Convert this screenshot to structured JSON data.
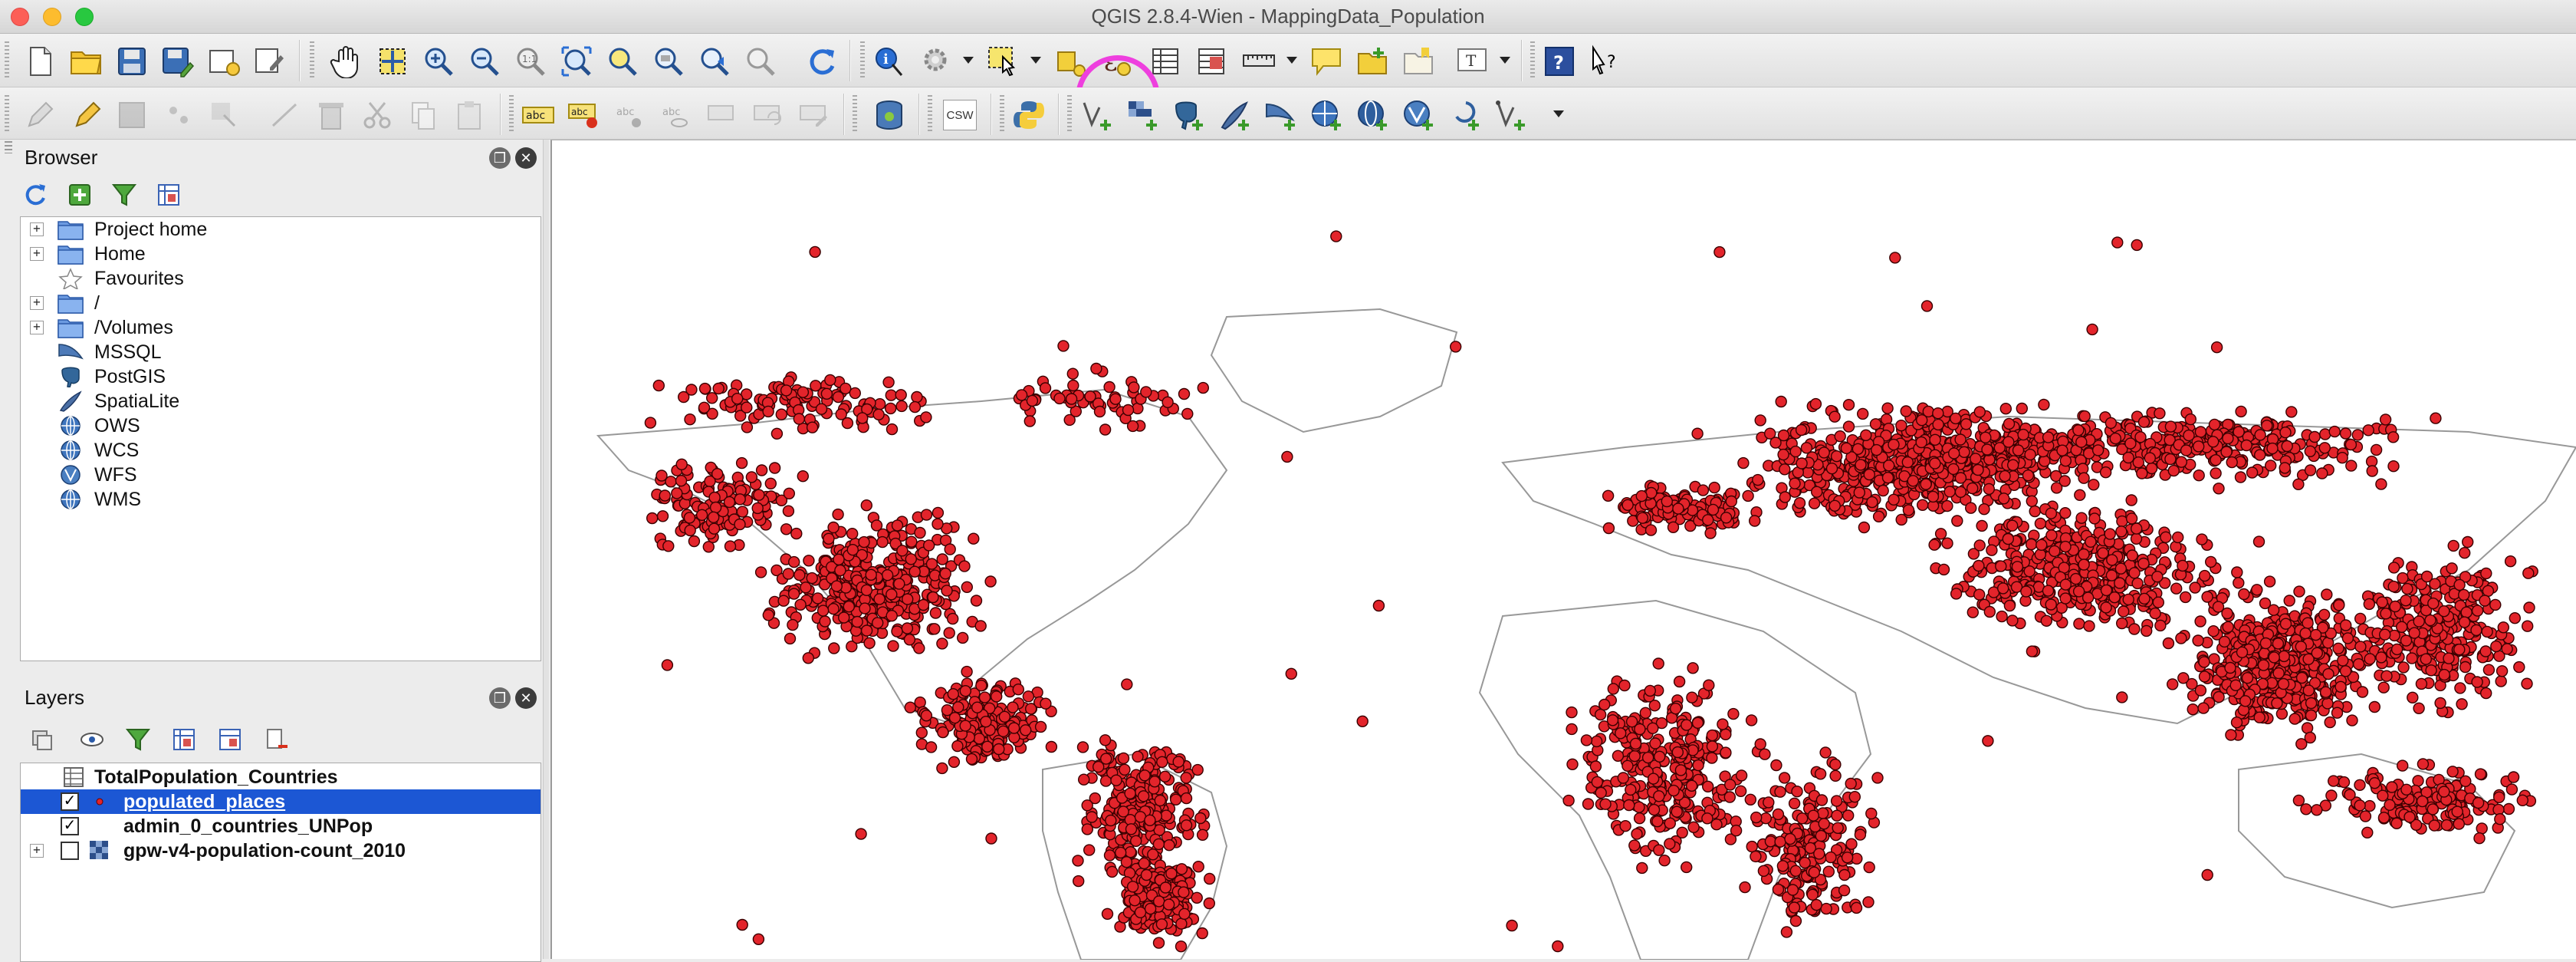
{
  "window": {
    "title": "QGIS 2.8.4-Wien - MappingData_Population"
  },
  "toolbar1": {
    "icons": [
      "new-project",
      "open-project",
      "save-project",
      "save-as",
      "new-print-composer",
      "composer-manager",
      "pan-map",
      "pan-to-selection",
      "zoom-in",
      "zoom-out",
      "zoom-native",
      "zoom-full",
      "zoom-to-selection",
      "zoom-to-layer",
      "zoom-last",
      "zoom-next",
      "refresh",
      "identify-features",
      "run-feature-action",
      "select-features",
      "deselect-all",
      "select-by-expression",
      "open-attribute-table",
      "open-field-calculator",
      "measure-line",
      "show-map-tips",
      "new-bookmark",
      "show-bookmarks",
      "text-annotation",
      "help-contents",
      "whats-this"
    ],
    "highlighted": "select-by-expression"
  },
  "toolbar2": {
    "labels": {
      "csw": "CSW"
    }
  },
  "browser": {
    "title": "Browser",
    "items": [
      {
        "label": "Project home",
        "expandable": true,
        "icon": "folder"
      },
      {
        "label": "Home",
        "expandable": true,
        "icon": "folder"
      },
      {
        "label": "Favourites",
        "expandable": false,
        "icon": "star"
      },
      {
        "label": "/",
        "expandable": true,
        "icon": "folder"
      },
      {
        "label": "/Volumes",
        "expandable": true,
        "icon": "folder"
      },
      {
        "label": "MSSQL",
        "expandable": false,
        "icon": "mssql"
      },
      {
        "label": "PostGIS",
        "expandable": false,
        "icon": "postgis"
      },
      {
        "label": "SpatiaLite",
        "expandable": false,
        "icon": "spatialite"
      },
      {
        "label": "OWS",
        "expandable": false,
        "icon": "globe"
      },
      {
        "label": "WCS",
        "expandable": false,
        "icon": "globe"
      },
      {
        "label": "WFS",
        "expandable": false,
        "icon": "wfs"
      },
      {
        "label": "WMS",
        "expandable": false,
        "icon": "globe"
      }
    ]
  },
  "layers": {
    "title": "Layers",
    "items": [
      {
        "label": "TotalPopulation_Countries",
        "checked": null,
        "selected": false,
        "icon": "table"
      },
      {
        "label": "populated_places",
        "checked": true,
        "selected": true,
        "icon": "point"
      },
      {
        "label": "admin_0_countries_UNPop",
        "checked": true,
        "selected": false,
        "icon": "none"
      },
      {
        "label": "gpw-v4-population-count_2010",
        "checked": false,
        "selected": false,
        "icon": "raster",
        "expandable": true
      }
    ]
  },
  "map": {
    "point_fill": "#e3242b",
    "point_stroke": "#3a0000",
    "boundary_color": "#444444"
  },
  "colors": {
    "highlight": "#ee3fde",
    "selection": "#1c57d4"
  }
}
